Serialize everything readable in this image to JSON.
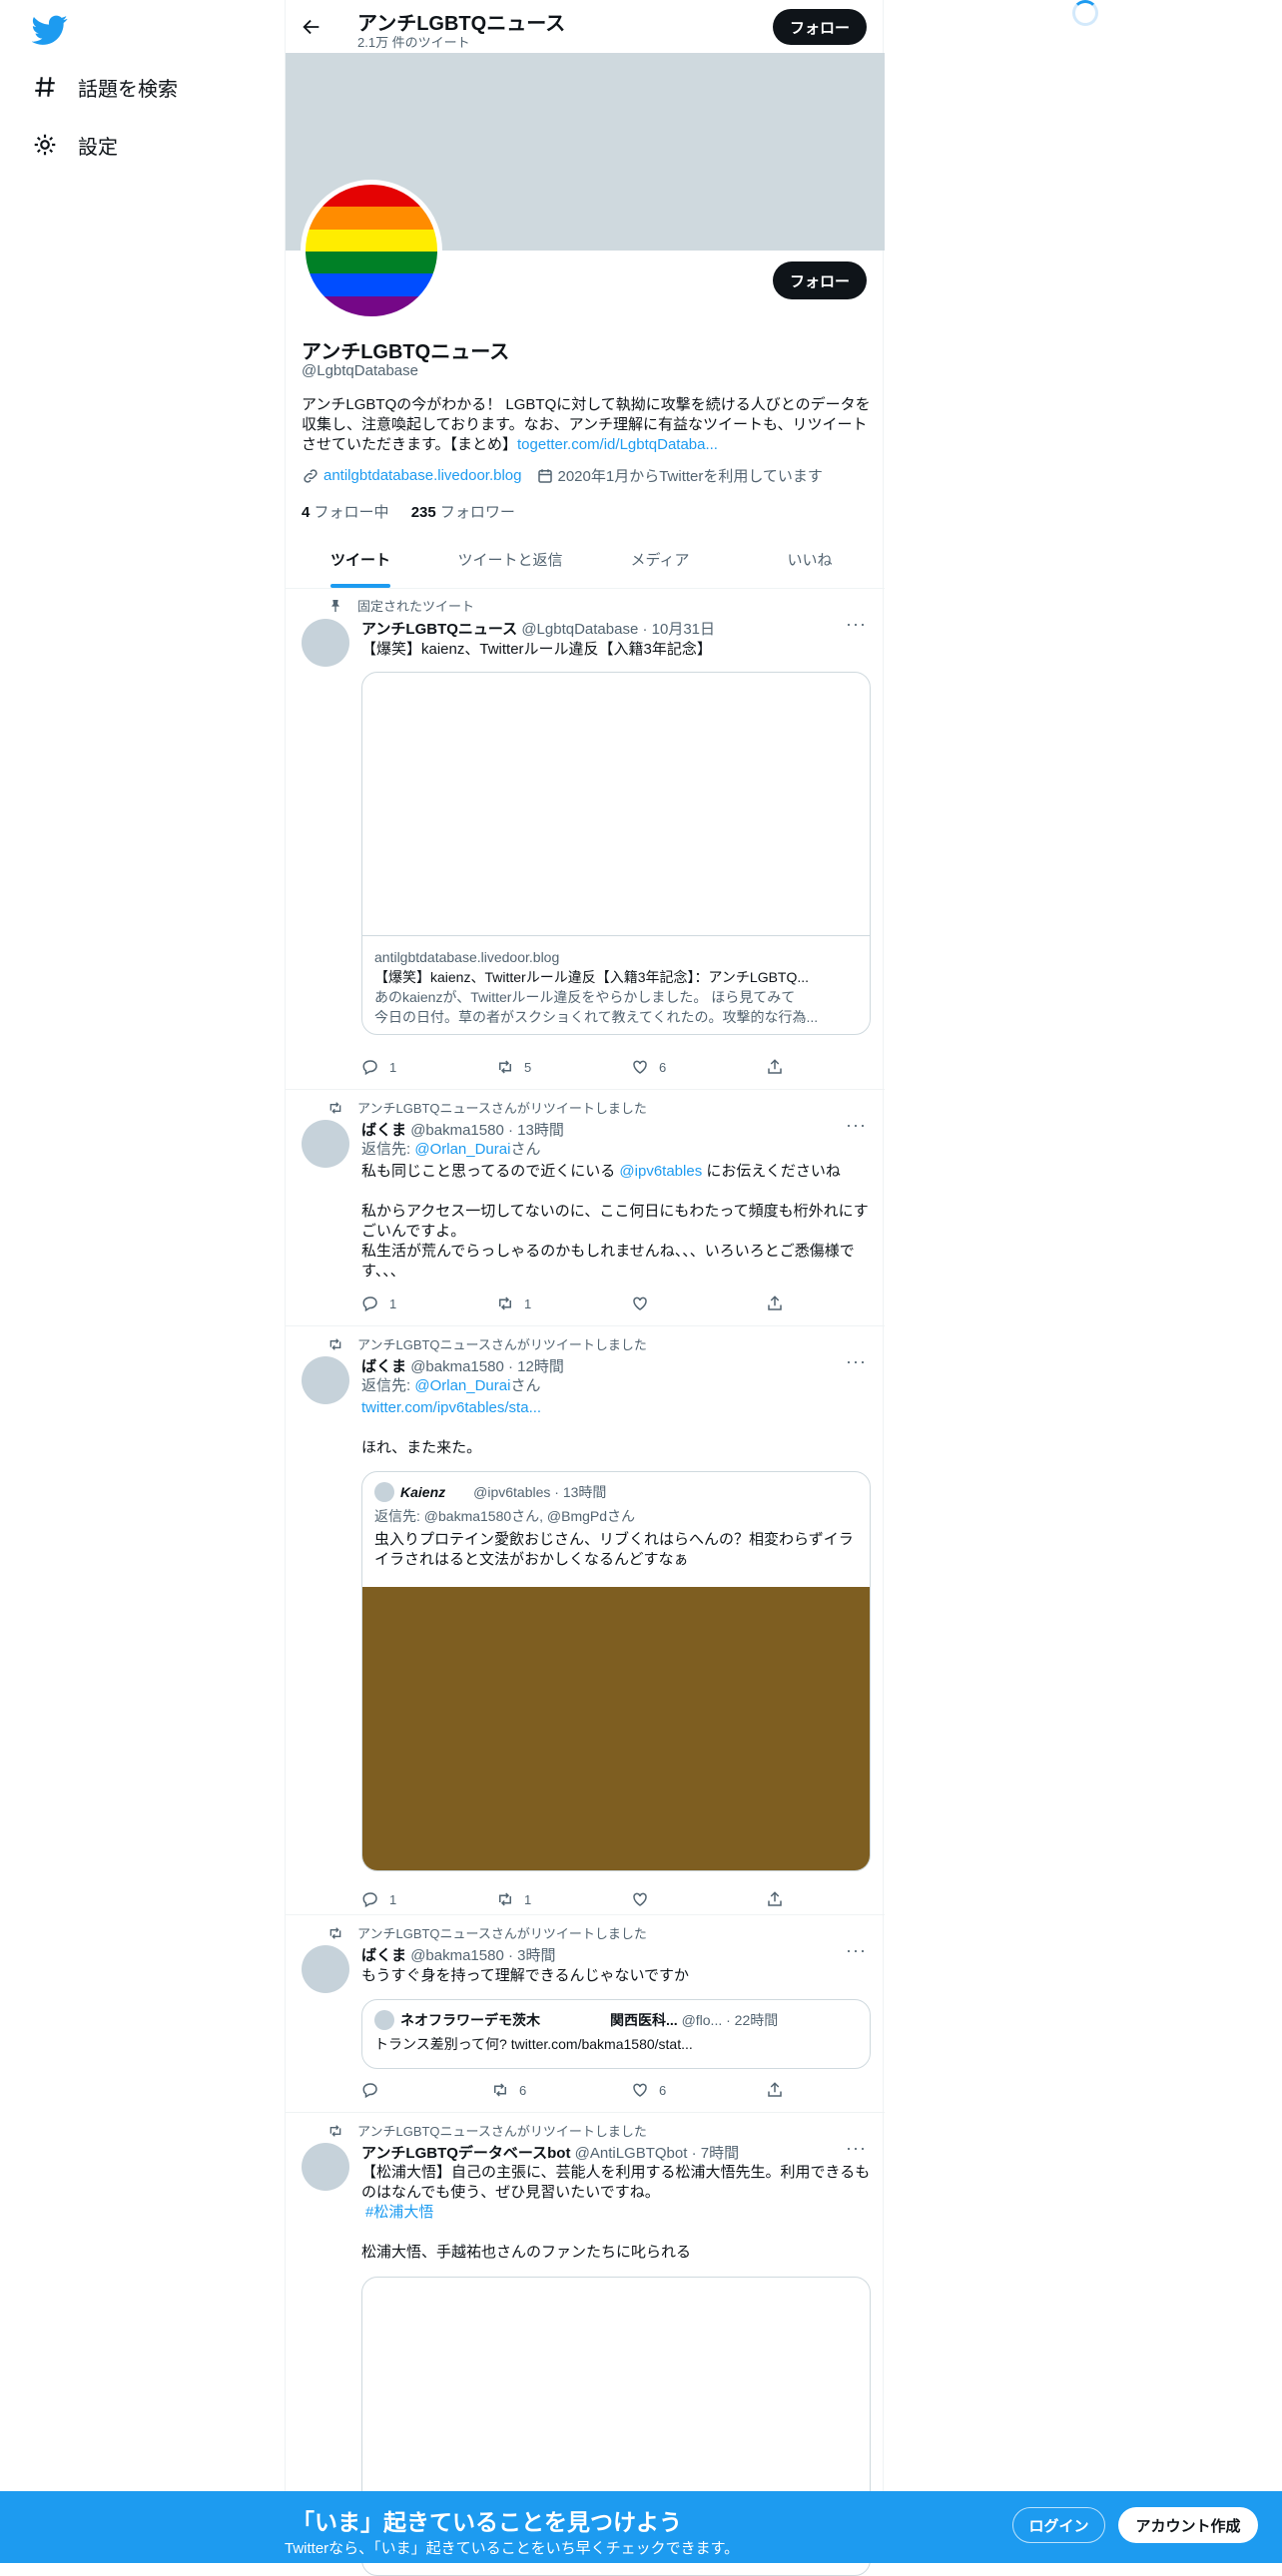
{
  "nav": {
    "explore": "話題を検索",
    "settings": "設定"
  },
  "header": {
    "title": "アンチLGBTQニュース",
    "subtitle": "2.1万 件のツイート",
    "follow": "フォロー"
  },
  "profile": {
    "name": "アンチLGBTQニュース",
    "handle": "@LgbtqDatabase",
    "follow": "フォロー",
    "bio": "アンチLGBTQの今がわかる！ LGBTQに対して執拗に攻撃を続ける人びとのデータを収集し、注意喚起しております。なお、アンチ理解に有益なツイートも、リツイートさせていただきます。【まとめ】",
    "bio_link": "togetter.com/id/LgbtqDataba...",
    "website": "antilgbtdatabase.livedoor.blog",
    "joined": "2020年1月からTwitterを利用しています",
    "following_count": "4",
    "following_label": " フォロー中",
    "followers_count": "235",
    "followers_label": " フォロワー",
    "flag_colors": [
      "#e40303",
      "#ff8c00",
      "#ffed00",
      "#008026",
      "#004dff",
      "#750787"
    ]
  },
  "tabs": [
    "ツイート",
    "ツイートと返信",
    "メディア",
    "いいね"
  ],
  "t1": {
    "pin": "固定されたツイート",
    "name": "アンチLGBTQニュース",
    "handle": "@LgbtqDatabase",
    "time": "· 10月31日",
    "text": "【爆笑】kaienz、Twitterルール違反【入籍3年記念】",
    "card_domain": "antilgbtdatabase.livedoor.blog",
    "card_title": "【爆笑】kaienz、Twitterルール違反【入籍3年記念】：アンチLGBTQ...",
    "card_desc1": "あのkaienzが、Twitterルール違反をやらかしました。 ほら見てみて",
    "card_desc2": "今日の日付。草の者がスクショくれて教えてくれたの。攻撃的な行為...",
    "reply": "1",
    "rt": "5",
    "like": "6"
  },
  "t2": {
    "social": "アンチLGBTQニュースさんがリツイートしました",
    "name": "ばくま",
    "handle": "@bakma1580",
    "time": "· 13時間",
    "reply_prefix": "返信先: ",
    "reply_to": "@Orlan_Durai",
    "reply_suffix": "さん",
    "line1a": "私も同じこと思ってるので近くにいる ",
    "line1b": "@ipv6tables",
    "line1c": " にお伝えくださいね",
    "para2": "私からアクセス一切してないのに、ここ何日にもわたって頻度も桁外れにすごいんですよ。",
    "para3": "私生活が荒んでらっしゃるのかもしれませんね、、、いろいろとご悉傷様です、、、",
    "reply": "1",
    "rt": "1"
  },
  "t3": {
    "social": "アンチLGBTQニュースさんがリツイートしました",
    "name": "ばくま",
    "handle": "@bakma1580",
    "time": "· 12時間",
    "reply_prefix": "返信先: ",
    "reply_to": "@Orlan_Durai",
    "reply_suffix": "さん",
    "link": "twitter.com/ipv6tables/sta...",
    "text": "ほれ、また来た。",
    "q_name": "Kaienz",
    "q_handle": "@ipv6tables",
    "q_time": "· 13時間",
    "q_reply": "返信先: @bakma1580さん, @BmgPdさん",
    "q_text": "虫入りプロテイン愛飲おじさん、リブくれはらへんの？相変わらずイライラされはると文法がおかしくなるんどすなぁ",
    "q_img_color": "#7e5e21",
    "reply": "1",
    "rt": "1"
  },
  "t4": {
    "social": "アンチLGBTQニュースさんがリツイートしました",
    "name": "ばくま",
    "handle": "@bakma1580",
    "time": "· 3時間",
    "text": "もうすぐ身を持って理解できるんじゃないですか",
    "q_name": "ネオフラワーデモ茨木　　　　　関西医科...",
    "q_handle": "@flo...",
    "q_time": "· 22時間",
    "q_text": "トランス差別って何? twitter.com/bakma1580/stat...",
    "rt": "6",
    "like": "6"
  },
  "t5": {
    "social": "アンチLGBTQニュースさんがリツイートしました",
    "name": "アンチLGBTQデータベースbot",
    "handle": "@AntiLGBTQbot",
    "time": "· 7時間",
    "text": "【松浦大悟】自己の主張に、芸能人を利用する松浦大悟先生。利用できるものはなんでも使う、ぜひ見習いたいですね。",
    "tag": "#松浦大悟",
    "text2": "松浦大悟、手越祐也さんのファンたちに叱られる"
  },
  "bottom": {
    "title": "「いま」起きていることを見つけよう",
    "subtitle": "Twitterなら、「いま」起きていることをいち早くチェックできます。",
    "login": "ログイン",
    "signup": "アカウント作成"
  },
  "colors": {
    "accent": "#1d9bf0",
    "banner": "#cfd9de"
  }
}
